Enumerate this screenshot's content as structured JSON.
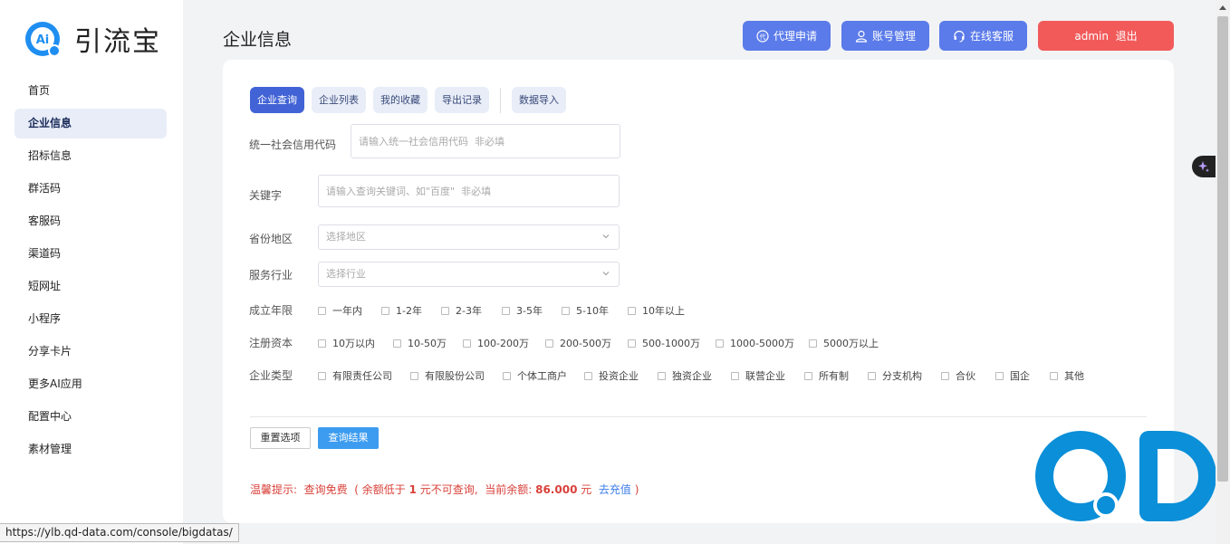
{
  "brand": {
    "name": "引流宝",
    "mark_text": "Ai"
  },
  "sidebar": {
    "items": [
      {
        "label": "首页"
      },
      {
        "label": "企业信息"
      },
      {
        "label": "招标信息"
      },
      {
        "label": "群活码"
      },
      {
        "label": "客服码"
      },
      {
        "label": "渠道码"
      },
      {
        "label": "短网址"
      },
      {
        "label": "小程序"
      },
      {
        "label": "分享卡片"
      },
      {
        "label": "更多AI应用"
      },
      {
        "label": "配置中心"
      },
      {
        "label": "素材管理"
      }
    ],
    "active_index": 1
  },
  "header": {
    "title": "企业信息",
    "buttons": {
      "agent": "代理申请",
      "account": "账号管理",
      "service": "在线客服",
      "logout": "admin  退出"
    }
  },
  "tabs": [
    {
      "label": "企业查询"
    },
    {
      "label": "企业列表"
    },
    {
      "label": "我的收藏"
    },
    {
      "label": "导出记录"
    },
    {
      "label": "数据导入"
    }
  ],
  "form": {
    "credit_code": {
      "label": "统一社会信用代码",
      "placeholder": "请输入统一社会信用代码  非必填",
      "value": ""
    },
    "keyword": {
      "label": "关键字",
      "placeholder": "请输入查询关键词、如\"百度\"  非必填",
      "value": ""
    },
    "region": {
      "label": "省份地区",
      "placeholder": "选择地区"
    },
    "industry": {
      "label": "服务行业",
      "placeholder": "选择行业"
    },
    "years": {
      "label": "成立年限",
      "options": [
        "一年内",
        "1-2年",
        "2-3年",
        "3-5年",
        "5-10年",
        "10年以上"
      ]
    },
    "capital": {
      "label": "注册资本",
      "options": [
        "10万以内",
        "10-50万",
        "100-200万",
        "200-500万",
        "500-1000万",
        "1000-5000万",
        "5000万以上"
      ]
    },
    "type": {
      "label": "企业类型",
      "options": [
        "有限责任公司",
        "有限股份公司",
        "个体工商户",
        "投资企业",
        "独资企业",
        "联营企业",
        "所有制",
        "分支机构",
        "合伙",
        "国企",
        "其他"
      ]
    }
  },
  "actions": {
    "reset": "重置选项",
    "query": "查询结果"
  },
  "hint": {
    "prefix": "温馨提示:  查询免费  ( 余额低于 ",
    "min": "1",
    "mid": " 元不可查询,  当前余额: ",
    "balance": "86.000",
    "unit": " 元  ",
    "recharge": "去充值",
    "suffix": " )"
  },
  "status_url": "https://ylb.qd-data.com/console/bigdatas/",
  "colors": {
    "primary": "#5b7bea",
    "tab_active": "#4263d6",
    "danger": "#f25a5a",
    "query": "#3d9cf0",
    "qd_logo": "#0a8fd8"
  }
}
